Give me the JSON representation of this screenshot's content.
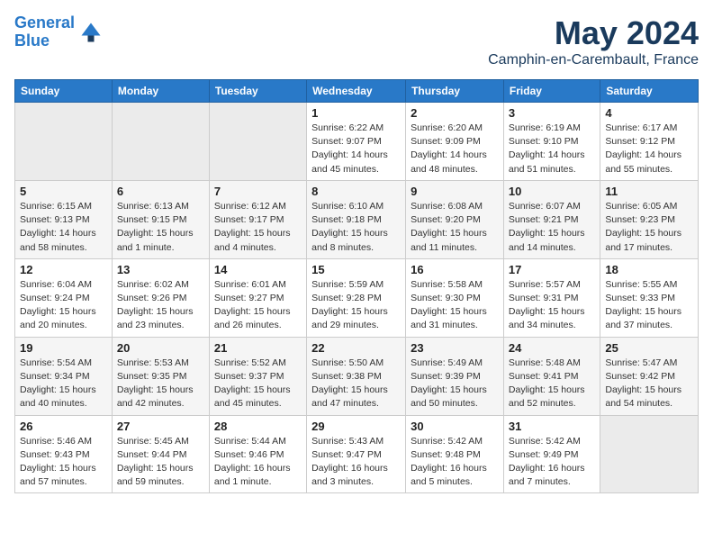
{
  "logo": {
    "line1": "General",
    "line2": "Blue"
  },
  "title": "May 2024",
  "location": "Camphin-en-Carembault, France",
  "weekdays": [
    "Sunday",
    "Monday",
    "Tuesday",
    "Wednesday",
    "Thursday",
    "Friday",
    "Saturday"
  ],
  "weeks": [
    [
      {
        "day": "",
        "empty": true
      },
      {
        "day": "",
        "empty": true
      },
      {
        "day": "",
        "empty": true
      },
      {
        "day": "1",
        "sunrise": "Sunrise: 6:22 AM",
        "sunset": "Sunset: 9:07 PM",
        "daylight": "Daylight: 14 hours and 45 minutes."
      },
      {
        "day": "2",
        "sunrise": "Sunrise: 6:20 AM",
        "sunset": "Sunset: 9:09 PM",
        "daylight": "Daylight: 14 hours and 48 minutes."
      },
      {
        "day": "3",
        "sunrise": "Sunrise: 6:19 AM",
        "sunset": "Sunset: 9:10 PM",
        "daylight": "Daylight: 14 hours and 51 minutes."
      },
      {
        "day": "4",
        "sunrise": "Sunrise: 6:17 AM",
        "sunset": "Sunset: 9:12 PM",
        "daylight": "Daylight: 14 hours and 55 minutes."
      }
    ],
    [
      {
        "day": "5",
        "sunrise": "Sunrise: 6:15 AM",
        "sunset": "Sunset: 9:13 PM",
        "daylight": "Daylight: 14 hours and 58 minutes."
      },
      {
        "day": "6",
        "sunrise": "Sunrise: 6:13 AM",
        "sunset": "Sunset: 9:15 PM",
        "daylight": "Daylight: 15 hours and 1 minute."
      },
      {
        "day": "7",
        "sunrise": "Sunrise: 6:12 AM",
        "sunset": "Sunset: 9:17 PM",
        "daylight": "Daylight: 15 hours and 4 minutes."
      },
      {
        "day": "8",
        "sunrise": "Sunrise: 6:10 AM",
        "sunset": "Sunset: 9:18 PM",
        "daylight": "Daylight: 15 hours and 8 minutes."
      },
      {
        "day": "9",
        "sunrise": "Sunrise: 6:08 AM",
        "sunset": "Sunset: 9:20 PM",
        "daylight": "Daylight: 15 hours and 11 minutes."
      },
      {
        "day": "10",
        "sunrise": "Sunrise: 6:07 AM",
        "sunset": "Sunset: 9:21 PM",
        "daylight": "Daylight: 15 hours and 14 minutes."
      },
      {
        "day": "11",
        "sunrise": "Sunrise: 6:05 AM",
        "sunset": "Sunset: 9:23 PM",
        "daylight": "Daylight: 15 hours and 17 minutes."
      }
    ],
    [
      {
        "day": "12",
        "sunrise": "Sunrise: 6:04 AM",
        "sunset": "Sunset: 9:24 PM",
        "daylight": "Daylight: 15 hours and 20 minutes."
      },
      {
        "day": "13",
        "sunrise": "Sunrise: 6:02 AM",
        "sunset": "Sunset: 9:26 PM",
        "daylight": "Daylight: 15 hours and 23 minutes."
      },
      {
        "day": "14",
        "sunrise": "Sunrise: 6:01 AM",
        "sunset": "Sunset: 9:27 PM",
        "daylight": "Daylight: 15 hours and 26 minutes."
      },
      {
        "day": "15",
        "sunrise": "Sunrise: 5:59 AM",
        "sunset": "Sunset: 9:28 PM",
        "daylight": "Daylight: 15 hours and 29 minutes."
      },
      {
        "day": "16",
        "sunrise": "Sunrise: 5:58 AM",
        "sunset": "Sunset: 9:30 PM",
        "daylight": "Daylight: 15 hours and 31 minutes."
      },
      {
        "day": "17",
        "sunrise": "Sunrise: 5:57 AM",
        "sunset": "Sunset: 9:31 PM",
        "daylight": "Daylight: 15 hours and 34 minutes."
      },
      {
        "day": "18",
        "sunrise": "Sunrise: 5:55 AM",
        "sunset": "Sunset: 9:33 PM",
        "daylight": "Daylight: 15 hours and 37 minutes."
      }
    ],
    [
      {
        "day": "19",
        "sunrise": "Sunrise: 5:54 AM",
        "sunset": "Sunset: 9:34 PM",
        "daylight": "Daylight: 15 hours and 40 minutes."
      },
      {
        "day": "20",
        "sunrise": "Sunrise: 5:53 AM",
        "sunset": "Sunset: 9:35 PM",
        "daylight": "Daylight: 15 hours and 42 minutes."
      },
      {
        "day": "21",
        "sunrise": "Sunrise: 5:52 AM",
        "sunset": "Sunset: 9:37 PM",
        "daylight": "Daylight: 15 hours and 45 minutes."
      },
      {
        "day": "22",
        "sunrise": "Sunrise: 5:50 AM",
        "sunset": "Sunset: 9:38 PM",
        "daylight": "Daylight: 15 hours and 47 minutes."
      },
      {
        "day": "23",
        "sunrise": "Sunrise: 5:49 AM",
        "sunset": "Sunset: 9:39 PM",
        "daylight": "Daylight: 15 hours and 50 minutes."
      },
      {
        "day": "24",
        "sunrise": "Sunrise: 5:48 AM",
        "sunset": "Sunset: 9:41 PM",
        "daylight": "Daylight: 15 hours and 52 minutes."
      },
      {
        "day": "25",
        "sunrise": "Sunrise: 5:47 AM",
        "sunset": "Sunset: 9:42 PM",
        "daylight": "Daylight: 15 hours and 54 minutes."
      }
    ],
    [
      {
        "day": "26",
        "sunrise": "Sunrise: 5:46 AM",
        "sunset": "Sunset: 9:43 PM",
        "daylight": "Daylight: 15 hours and 57 minutes."
      },
      {
        "day": "27",
        "sunrise": "Sunrise: 5:45 AM",
        "sunset": "Sunset: 9:44 PM",
        "daylight": "Daylight: 15 hours and 59 minutes."
      },
      {
        "day": "28",
        "sunrise": "Sunrise: 5:44 AM",
        "sunset": "Sunset: 9:46 PM",
        "daylight": "Daylight: 16 hours and 1 minute."
      },
      {
        "day": "29",
        "sunrise": "Sunrise: 5:43 AM",
        "sunset": "Sunset: 9:47 PM",
        "daylight": "Daylight: 16 hours and 3 minutes."
      },
      {
        "day": "30",
        "sunrise": "Sunrise: 5:42 AM",
        "sunset": "Sunset: 9:48 PM",
        "daylight": "Daylight: 16 hours and 5 minutes."
      },
      {
        "day": "31",
        "sunrise": "Sunrise: 5:42 AM",
        "sunset": "Sunset: 9:49 PM",
        "daylight": "Daylight: 16 hours and 7 minutes."
      },
      {
        "day": "",
        "empty": true
      }
    ]
  ]
}
